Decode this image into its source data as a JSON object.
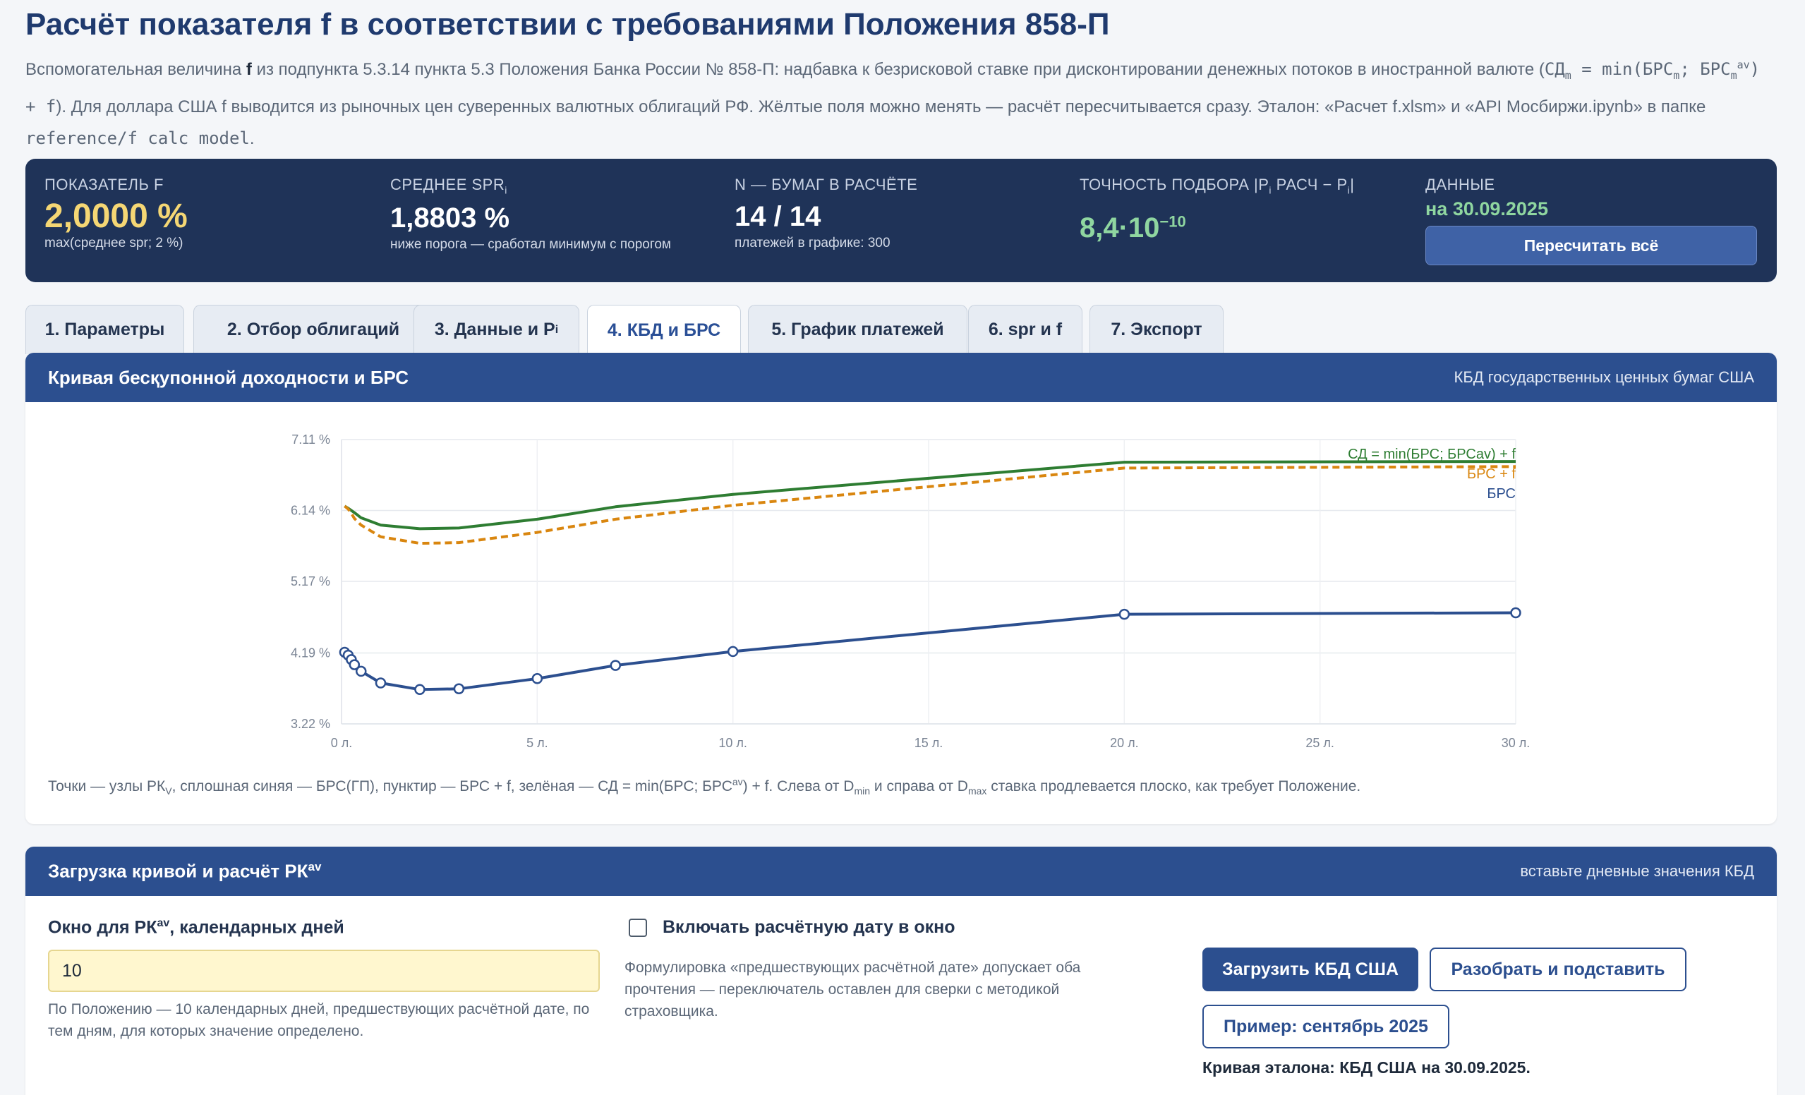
{
  "header": {
    "title": "Расчёт показателя f в соответствии с требованиями Положения 858-П",
    "intro_a": "Вспомогательная величина ",
    "intro_f": "f",
    "intro_b": " из подпункта 5.3.14 пункта 5.3 Положения Банка России № 858-П: надбавка к безрисковой ставке при дисконтировании денежных потоков в иностранной валюте (",
    "intro_formula_a": "СД",
    "intro_sub_m1": "m",
    "intro_formula_b": " = min(БРС",
    "intro_sub_m2": "m",
    "intro_formula_c": "; БРС",
    "intro_sub_m3": "m",
    "intro_sup_av": "av",
    "intro_formula_d": ") + f",
    "intro_c": "). Для доллара США f выводится из рыночных цен суверенных валютных облигаций РФ. Жёлтые поля можно менять — расчёт пересчитывается сразу. Эталон: «Расчет f.xlsm» и «API Мосбиржи.ipynb» в папке ",
    "intro_path": "reference/f calc model",
    "intro_end": "."
  },
  "summary": {
    "f_label": "ПОКАЗАТЕЛЬ F",
    "f_value": "2,0000 %",
    "f_note": "max(среднее spr; 2 %)",
    "spr_label": "СРЕДНЕЕ SPR",
    "spr_sub": "i",
    "spr_value": "1,8803 %",
    "spr_note": "ниже порога — сработал минимум с порогом",
    "n_label": "N — БУМАГ В РАСЧЁТЕ",
    "n_value": "14 / 14",
    "n_note": "платежей в графике: 300",
    "acc_label_a": "ТОЧНОСТЬ ПОДБОРА |P",
    "acc_sub_a": "i",
    "acc_label_b": " РАСЧ − P",
    "acc_sub_b": "i",
    "acc_label_c": "|",
    "acc_value_base": "8,4·10",
    "acc_value_exp": "−10",
    "data_label": "ДАННЫЕ",
    "data_value": "на 30.09.2025",
    "recalc_button": "Пересчитать всё"
  },
  "tabs": {
    "t1": "1. Параметры",
    "t2": "2. Отбор облигаций",
    "t3": "3. Данные и P",
    "t3_sub": "i",
    "t4": "4. КБД и БРС",
    "t5": "5. График платежей",
    "t6": "6. spr и f",
    "t7": "7. Экспорт",
    "active": "4. КБД и БРС"
  },
  "curve_card": {
    "title": "Кривая бесқупонной доходности и БРС",
    "subtitle": "КБД государственных ценных бумаг США",
    "caption_a": "Точки — узлы РК",
    "caption_sub_v": "V",
    "caption_b": ", сплошная синяя — БРС(ГП), пунктир — БРС + f, зелёная — СД = min(БРС; БРС",
    "caption_sup_av": "av",
    "caption_c": ") + f. Слева от D",
    "caption_sub_min": "min",
    "caption_d": " и справа от D",
    "caption_sub_max": "max",
    "caption_e": " ставка продлевается плоско, как требует Положение."
  },
  "chart_data": {
    "type": "line",
    "title": "",
    "xlabel": "",
    "ylabel": "",
    "xlim": [
      0,
      30
    ],
    "ylim": [
      3.22,
      7.11
    ],
    "x_ticks": [
      0,
      5,
      10,
      15,
      20,
      25,
      30
    ],
    "x_tick_labels": [
      "0 л.",
      "5 л.",
      "10 л.",
      "15 л.",
      "20 л.",
      "25 л.",
      "30 л."
    ],
    "y_ticks": [
      3.22,
      4.19,
      5.17,
      6.14,
      7.11
    ],
    "y_tick_labels": [
      "3.22 %",
      "4.19 %",
      "5.17 %",
      "6.14 %",
      "7.11 %"
    ],
    "grid": true,
    "legend": "top-right",
    "series": [
      {
        "name": "СД = min(БРС; БРСav) + f",
        "color": "#2e7d32",
        "style": "solid",
        "x": [
          0.08,
          0.17,
          0.25,
          0.33,
          0.5,
          1,
          2,
          3,
          5,
          7,
          10,
          20,
          30
        ],
        "y": [
          6.2,
          6.17,
          6.14,
          6.11,
          6.04,
          5.94,
          5.89,
          5.9,
          6.02,
          6.19,
          6.36,
          6.8,
          6.81
        ]
      },
      {
        "name": "БРС + f",
        "color": "#d9860f",
        "style": "dashed",
        "x": [
          0.08,
          0.17,
          0.25,
          0.33,
          0.5,
          1,
          2,
          3,
          5,
          7,
          10,
          20,
          30
        ],
        "y": [
          6.2,
          6.16,
          6.1,
          6.03,
          5.94,
          5.78,
          5.69,
          5.7,
          5.84,
          6.02,
          6.21,
          6.72,
          6.74
        ]
      },
      {
        "name": "БРС",
        "color": "#2c4f8f",
        "style": "solid",
        "markers": true,
        "x": [
          0.08,
          0.17,
          0.25,
          0.33,
          0.5,
          1,
          2,
          3,
          5,
          7,
          10,
          20,
          30
        ],
        "y": [
          4.2,
          4.16,
          4.1,
          4.03,
          3.94,
          3.78,
          3.69,
          3.7,
          3.84,
          4.02,
          4.21,
          4.72,
          4.74
        ]
      }
    ]
  },
  "load_card": {
    "title": "Загрузка кривой и расчёт РК",
    "title_sup": "av",
    "subtitle": "вставьте дневные значения КБД",
    "window_label": "Окно для РК",
    "window_label_sup": "av",
    "window_label_b": ", календарных дней",
    "window_value": "10",
    "window_hint": "По Положению — 10 календарных дней, предшествующих расчётной дате, по тем дням, для которых значение определено.",
    "include_label": "Включать расчётную дату в окно",
    "include_hint": "Формулировка «предшествующих расчётной дате» допускает оба прочтения — переключатель оставлен для сверки с методикой страховщика.",
    "load_button": "Загрузить КБД США",
    "parse_button": "Разобрать и подставить",
    "example_button": "Пример: сентябрь 2025",
    "reference_note": "Кривая эталона: КБД США на 30.09.2025."
  }
}
